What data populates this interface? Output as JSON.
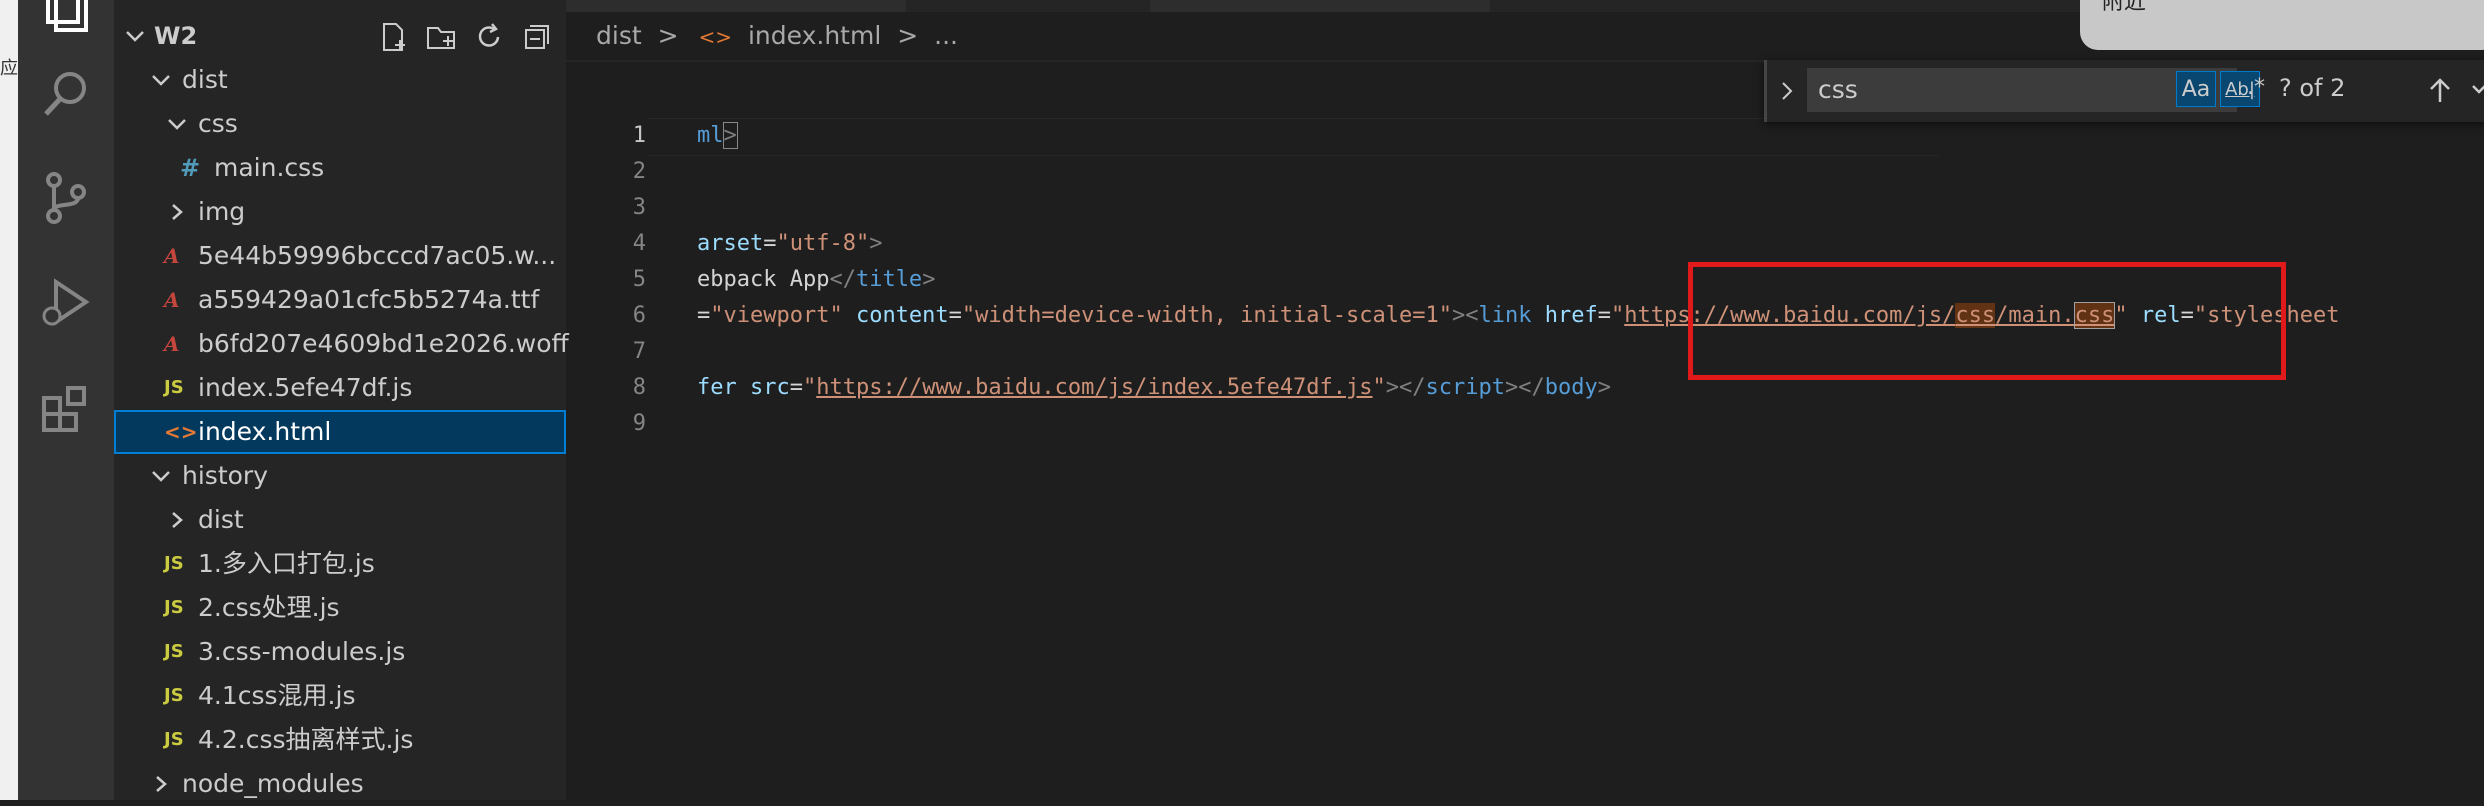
{
  "edge_label": "应",
  "activity_bar": {
    "icons": [
      "explorer-icon",
      "search-icon",
      "source-control-icon",
      "run-debug-icon",
      "extensions-icon"
    ]
  },
  "sidebar": {
    "title": "W2",
    "tree": [
      {
        "label": "dist",
        "type": "folder",
        "expanded": true
      },
      {
        "label": "css",
        "type": "folder",
        "expanded": true
      },
      {
        "label": "main.css",
        "type": "css",
        "icon": "#"
      },
      {
        "label": "img",
        "type": "folder",
        "expanded": false
      },
      {
        "label": "5e44b59996bcccd7ac05.w...",
        "type": "font",
        "icon": "A"
      },
      {
        "label": "a559429a01cfc5b5274a.ttf",
        "type": "font",
        "icon": "A"
      },
      {
        "label": "b6fd207e4609bd1e2026.woff",
        "type": "font",
        "icon": "A"
      },
      {
        "label": "index.5efe47df.js",
        "type": "js",
        "icon": "JS"
      },
      {
        "label": "index.html",
        "type": "html",
        "icon": "<>"
      },
      {
        "label": "history",
        "type": "folder",
        "expanded": true
      },
      {
        "label": "dist",
        "type": "folder",
        "expanded": false
      },
      {
        "label": "1.多入口打包.js",
        "type": "js",
        "icon": "JS"
      },
      {
        "label": "2.css处理.js",
        "type": "js",
        "icon": "JS"
      },
      {
        "label": "3.css-modules.js",
        "type": "js",
        "icon": "JS"
      },
      {
        "label": "4.1css混用.js",
        "type": "js",
        "icon": "JS"
      },
      {
        "label": "4.2.css抽离样式.js",
        "type": "js",
        "icon": "JS"
      },
      {
        "label": "node_modules",
        "type": "folder",
        "expanded": false
      }
    ]
  },
  "breadcrumb": {
    "folder": "dist",
    "sep": ">",
    "file": "index.html",
    "more": "..."
  },
  "editor": {
    "line_numbers": [
      "1",
      "2",
      "3",
      "4",
      "5",
      "6",
      "7",
      "8",
      "9"
    ],
    "line1": {
      "text": "ml",
      "punc": ">"
    },
    "line4": {
      "attr": "arset",
      "eq": "=",
      "val": "\"utf-8\"",
      "close": ">"
    },
    "line5": {
      "text": "ebpack App",
      "tag_open": "</",
      "tag": "title",
      "tag_close": ">"
    },
    "line6": {
      "eq1": "=",
      "val1": "\"viewport\"",
      "attr2": " content",
      "eq2": "=",
      "val2": "\"width=device-width, initial-scale=1\"",
      "lt": "><",
      "tag": "link",
      "attr3": " href",
      "eq3": "=",
      "q1": "\"",
      "url_a": "https://www.baidu.com/js/",
      "url_css1": "css",
      "url_b": "/main.",
      "url_css2": "css",
      "q2": "\"",
      "attr4": " rel",
      "eq4": "=",
      "val4": "\"stylesheet"
    },
    "line8": {
      "attr1": "fer",
      "attr2": " src",
      "eq": "=",
      "q1": "\"",
      "url": "https://www.baidu.com/js/index.5efe47df.js",
      "q2": "\"",
      "close1": "></",
      "tag1": "script",
      "mid": "></",
      "tag2": "body",
      "close2": ">"
    }
  },
  "find_widget": {
    "query": "css",
    "match_case": "Aa",
    "whole_word": "Ab|",
    "regex": ".*",
    "count": "? of 2"
  },
  "notification": {
    "text": "附近"
  },
  "colors": {
    "annotation": "#e0191b",
    "selection": "#04395e",
    "accent": "#007fd4"
  }
}
